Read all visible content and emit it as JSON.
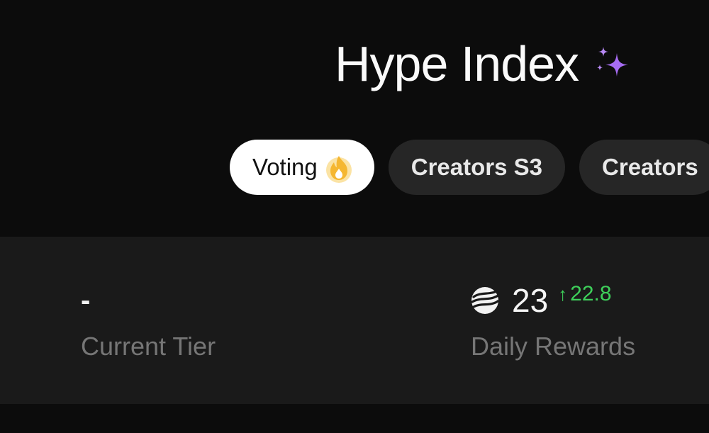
{
  "header": {
    "title": "Hype Index",
    "title_icon": "sparkle-icon"
  },
  "tabs": [
    {
      "label": "Voting",
      "icon": "flame-icon",
      "active": true
    },
    {
      "label": "Creators S3",
      "active": false
    },
    {
      "label": "Creators",
      "active": false
    }
  ],
  "stats": {
    "current_tier": {
      "value": "-",
      "label": "Current Tier"
    },
    "daily_rewards": {
      "icon": "coin-icon",
      "value": "23",
      "delta": "22.8",
      "delta_direction": "up",
      "label": "Daily Rewards"
    }
  },
  "colors": {
    "background": "#0c0c0c",
    "panel": "#1a1a1a",
    "tab_inactive": "#262626",
    "tab_active": "#ffffff",
    "positive": "#3ecf5a",
    "muted_text": "#767676",
    "sparkle": "#a66cf2",
    "flame": "#f5b731"
  }
}
